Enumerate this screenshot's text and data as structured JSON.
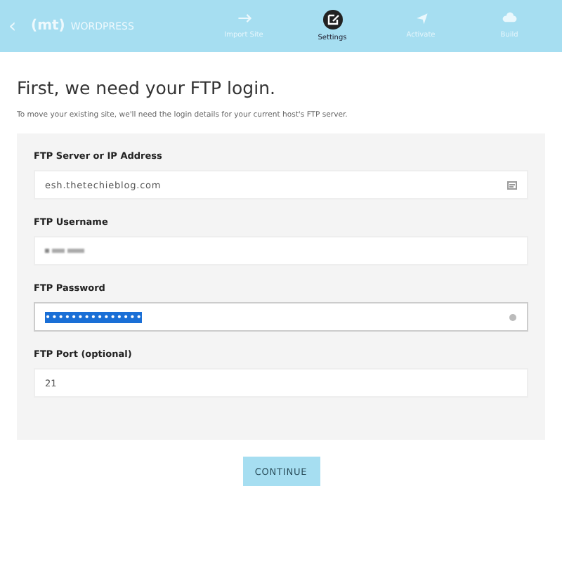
{
  "header": {
    "back": "‹",
    "logo_mark": "(mt)",
    "logo_text": "WORDPRESS",
    "steps": [
      {
        "label": "Import Site",
        "kind": "arrow",
        "selected": false
      },
      {
        "label": "Settings",
        "kind": "edit",
        "selected": true
      },
      {
        "label": "Activate",
        "kind": "plane",
        "selected": false
      },
      {
        "label": "Build",
        "kind": "cloud",
        "selected": false
      }
    ]
  },
  "title": "First, we need your FTP login.",
  "subtitle": "To move your existing site, we'll need the login details for your current host's FTP server.",
  "fields": [
    {
      "label": "FTP Server or IP Address",
      "kind": "server",
      "value": "esh.thetechieblog.com",
      "selected": false
    },
    {
      "label": "FTP Username",
      "kind": "blurred",
      "selected": false
    },
    {
      "label": "FTP Password",
      "kind": "password",
      "value": "•••••••••••••••",
      "selected": true
    },
    {
      "label": "FTP Port (optional)",
      "kind": "plain",
      "value": "21",
      "selected": false
    }
  ],
  "button": "CONTINUE"
}
